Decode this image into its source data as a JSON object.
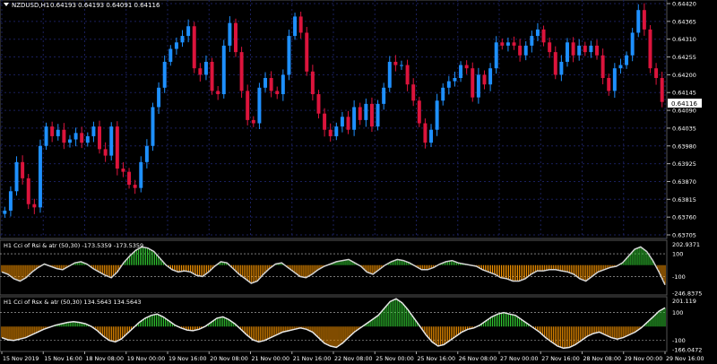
{
  "main": {
    "symbol_label": "NZDUSD,H1",
    "ohlc_label": "0.64193 0.64193 0.64091 0.64116",
    "price_ticks": [
      "0.64420",
      "0.64365",
      "0.64310",
      "0.64255",
      "0.64200",
      "0.64145",
      "0.64090",
      "0.64035",
      "0.63980",
      "0.63925",
      "0.63870",
      "0.63815",
      "0.63760",
      "0.63705"
    ],
    "current_price": "0.64116",
    "y_range": [
      0.63705,
      0.6442
    ],
    "colors": {
      "bull": "#1e90ff",
      "bear": "#dc143c",
      "grid": "#1a1f5c",
      "axis_text": "#ffffff",
      "price_tag_bg": "#ffffff",
      "price_tag_text": "#000000"
    }
  },
  "indicator1": {
    "label": "H1 Cci of Rsi & atr (50,30) -173.5359 -173.5359",
    "ticks": [
      "202.9371",
      "100",
      "-100",
      "-246.8375"
    ],
    "y_range": [
      -246.8375,
      202.9371
    ],
    "colors": {
      "positive": "#32cd32",
      "negative": "#ff9900",
      "line": "#d3d3d3",
      "level": "#bfbfbf"
    }
  },
  "indicator2": {
    "label": "H1 Cci of Rsx & atr (50,30) 134.5643 134.5643",
    "ticks": [
      "201.119",
      "100",
      "-100",
      "-166.0472"
    ],
    "y_range": [
      -166.0472,
      201.119
    ],
    "colors": {
      "positive": "#32cd32",
      "negative": "#ff9900",
      "line": "#e6e6e6",
      "level": "#bfbfbf"
    }
  },
  "time_axis": {
    "labels": [
      "15 Nov 2019",
      "15 Nov 16:00",
      "18 Nov 08:00",
      "19 Nov 00:00",
      "19 Nov 16:00",
      "20 Nov 08:00",
      "21 Nov 00:00",
      "21 Nov 16:00",
      "22 Nov 08:00",
      "25 Nov 00:00",
      "25 Nov 16:00",
      "26 Nov 08:00",
      "27 Nov 00:00",
      "27 Nov 16:00",
      "28 Nov 08:00",
      "29 Nov 00:00",
      "29 Nov 16:00"
    ]
  },
  "chart_data": [
    {
      "type": "candlestick",
      "title": "NZDUSD,H1",
      "ylim": [
        0.63705,
        0.6442
      ],
      "close_path": [
        0.6378,
        0.6384,
        0.6393,
        0.6388,
        0.638,
        0.6379,
        0.6398,
        0.6404,
        0.6401,
        0.6403,
        0.6399,
        0.64,
        0.6402,
        0.6399,
        0.6401,
        0.6404,
        0.6397,
        0.6395,
        0.6404,
        0.6391,
        0.639,
        0.6386,
        0.6385,
        0.6393,
        0.6398,
        0.641,
        0.6416,
        0.6424,
        0.6428,
        0.643,
        0.6432,
        0.6435,
        0.6422,
        0.642,
        0.6424,
        0.6415,
        0.6414,
        0.6429,
        0.6436,
        0.6427,
        0.6415,
        0.6406,
        0.6405,
        0.6416,
        0.6419,
        0.6415,
        0.6414,
        0.642,
        0.6432,
        0.6438,
        0.6433,
        0.6421,
        0.6414,
        0.6408,
        0.6403,
        0.6401,
        0.6404,
        0.6407,
        0.6403,
        0.641,
        0.6406,
        0.6411,
        0.6404,
        0.6411,
        0.6416,
        0.6424,
        0.6423,
        0.6423,
        0.6417,
        0.6412,
        0.6405,
        0.6399,
        0.6403,
        0.6412,
        0.6416,
        0.6418,
        0.6419,
        0.6423,
        0.6422,
        0.6413,
        0.642,
        0.6417,
        0.6422,
        0.643,
        0.6429,
        0.643,
        0.6429,
        0.6426,
        0.6429,
        0.6432,
        0.6434,
        0.643,
        0.6427,
        0.642,
        0.6424,
        0.643,
        0.6426,
        0.6429,
        0.6427,
        0.6429,
        0.6426,
        0.6419,
        0.6415,
        0.6422,
        0.6423,
        0.6426,
        0.6433,
        0.644,
        0.6434,
        0.6422,
        0.6419,
        0.64116
      ]
    },
    {
      "type": "area",
      "title": "H1 Cci of Rsi & atr (50,30)",
      "ylim": [
        -246.8375,
        202.9371
      ],
      "values": [
        -60,
        -80,
        -120,
        -140,
        -110,
        -60,
        -20,
        10,
        -10,
        -30,
        -40,
        -10,
        20,
        30,
        10,
        -30,
        -60,
        -90,
        -110,
        -60,
        20,
        80,
        130,
        160,
        150,
        120,
        60,
        0,
        -40,
        -60,
        -50,
        -60,
        -90,
        -100,
        -60,
        -10,
        30,
        20,
        -30,
        -80,
        -120,
        -160,
        -140,
        -80,
        -30,
        10,
        20,
        -20,
        -60,
        -100,
        -110,
        -80,
        -40,
        -10,
        10,
        30,
        40,
        50,
        20,
        -10,
        -60,
        -80,
        -40,
        0,
        30,
        50,
        40,
        20,
        -10,
        -40,
        -40,
        -20,
        10,
        30,
        40,
        20,
        10,
        0,
        -10,
        -40,
        -60,
        -80,
        -110,
        -120,
        -140,
        -140,
        -120,
        -80,
        -50,
        -50,
        -40,
        -40,
        -50,
        -60,
        -80,
        -120,
        -140,
        -100,
        -60,
        -40,
        -20,
        -10,
        20,
        80,
        140,
        160,
        120,
        40,
        -60,
        -173.5359
      ]
    },
    {
      "type": "area",
      "title": "H1 Cci of Rsx & atr (50,30)",
      "ylim": [
        -166.0472,
        201.119
      ],
      "values": [
        -80,
        -95,
        -100,
        -90,
        -80,
        -60,
        -40,
        -20,
        -5,
        10,
        20,
        30,
        35,
        30,
        20,
        0,
        -30,
        -70,
        -100,
        -110,
        -90,
        -50,
        -10,
        30,
        60,
        80,
        90,
        70,
        40,
        10,
        -10,
        -25,
        -30,
        -20,
        0,
        30,
        60,
        70,
        50,
        20,
        -20,
        -60,
        -95,
        -110,
        -100,
        -80,
        -60,
        -40,
        -30,
        -20,
        -10,
        -20,
        -40,
        -80,
        -120,
        -140,
        -150,
        -120,
        -80,
        -40,
        -10,
        20,
        50,
        80,
        130,
        180,
        200,
        170,
        120,
        60,
        0,
        -60,
        -110,
        -140,
        -130,
        -100,
        -70,
        -40,
        -20,
        -10,
        10,
        40,
        70,
        90,
        100,
        90,
        80,
        50,
        20,
        -10,
        -40,
        -80,
        -110,
        -140,
        -155,
        -150,
        -130,
        -100,
        -70,
        -50,
        -40,
        -60,
        -80,
        -90,
        -80,
        -60,
        -40,
        -10,
        30,
        70,
        110,
        134.5643
      ]
    }
  ]
}
